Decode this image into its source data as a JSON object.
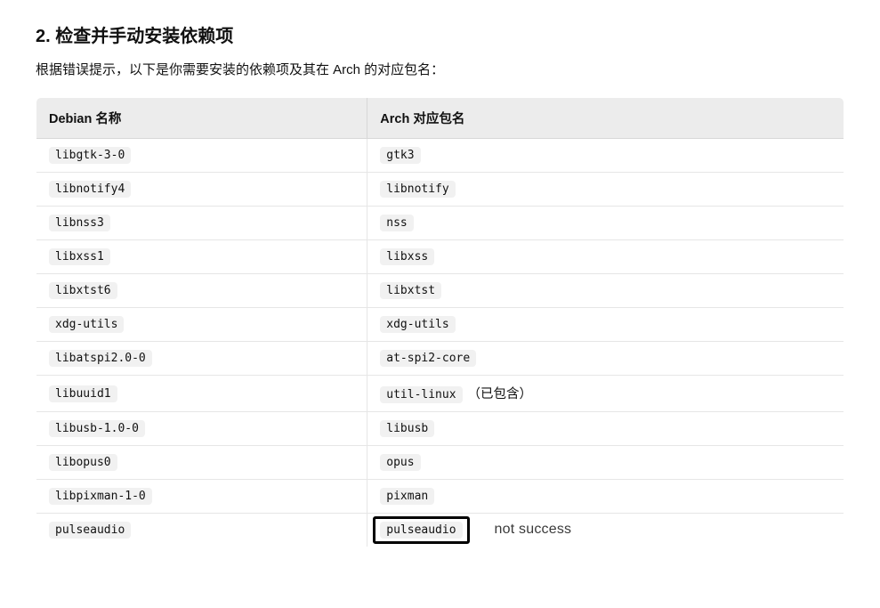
{
  "heading": "2. 检查并手动安装依赖项",
  "description": "根据错误提示，以下是你需要安装的依赖项及其在 Arch 的对应包名：",
  "table": {
    "headers": {
      "debian": "Debian 名称",
      "arch": "Arch 对应包名"
    },
    "rows": [
      {
        "debian": "libgtk-3-0",
        "arch": "gtk3",
        "suffix": ""
      },
      {
        "debian": "libnotify4",
        "arch": "libnotify",
        "suffix": ""
      },
      {
        "debian": "libnss3",
        "arch": "nss",
        "suffix": ""
      },
      {
        "debian": "libxss1",
        "arch": "libxss",
        "suffix": ""
      },
      {
        "debian": "libxtst6",
        "arch": "libxtst",
        "suffix": ""
      },
      {
        "debian": "xdg-utils",
        "arch": "xdg-utils",
        "suffix": ""
      },
      {
        "debian": "libatspi2.0-0",
        "arch": "at-spi2-core",
        "suffix": ""
      },
      {
        "debian": "libuuid1",
        "arch": "util-linux",
        "suffix": "（已包含）"
      },
      {
        "debian": "libusb-1.0-0",
        "arch": "libusb",
        "suffix": ""
      },
      {
        "debian": "libopus0",
        "arch": "opus",
        "suffix": ""
      },
      {
        "debian": "libpixman-1-0",
        "arch": "pixman",
        "suffix": ""
      },
      {
        "debian": "pulseaudio",
        "arch": "pulseaudio",
        "suffix": ""
      }
    ]
  },
  "annotation": {
    "text": "not success",
    "target_row_index": 11
  }
}
